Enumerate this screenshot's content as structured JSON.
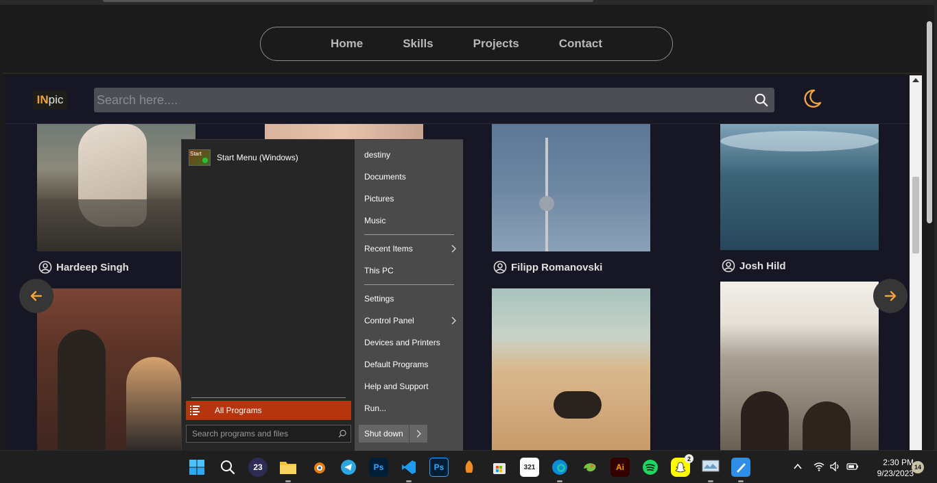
{
  "nav": {
    "items": [
      "Home",
      "Skills",
      "Projects",
      "Contact"
    ]
  },
  "header": {
    "logo_a": "IN",
    "logo_b": "pic",
    "search_placeholder": "Search here...."
  },
  "gallery": {
    "captions": [
      "Hardeep Singh",
      "Filipp Romanovski",
      "Josh Hild"
    ]
  },
  "start_menu": {
    "pinned_label": "Start Menu (Windows)",
    "pinned_icon_text": "Start",
    "all_programs": "All Programs",
    "search_placeholder": "Search programs and files",
    "right_items": [
      "destiny",
      "Documents",
      "Pictures",
      "Music",
      "Recent Items",
      "This PC",
      "Settings",
      "Control Panel",
      "Devices and Printers",
      "Default Programs",
      "Help and Support",
      "Run..."
    ],
    "shutdown": "Shut down"
  },
  "taskbar": {
    "time": "2:30 PM",
    "date": "9/23/2023",
    "notification_count": "14",
    "snapchat_badge": "2",
    "calendar_label": "23",
    "icons": [
      "windows-start",
      "search",
      "app-23",
      "file-explorer",
      "blender",
      "telegram",
      "photoshop",
      "vscode",
      "photoshop-alt",
      "fl-studio",
      "microsoft-store",
      "clapper-board",
      "edge",
      "chameleon",
      "illustrator",
      "spotify",
      "snapchat",
      "monitor",
      "paint"
    ]
  },
  "colors": {
    "accent_orange": "#f2a33b",
    "start_all_programs": "#b6350f",
    "inner_background": "#161624"
  }
}
